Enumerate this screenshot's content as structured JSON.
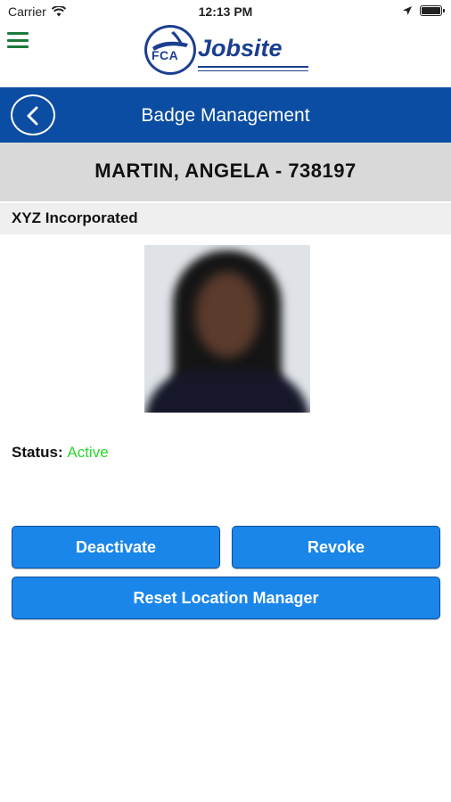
{
  "status_bar": {
    "carrier": "Carrier",
    "time": "12:13 PM",
    "battery_level": 1.0
  },
  "header": {
    "menu_icon": "hamburger-menu-icon",
    "logo_badge": "FCA",
    "logo_word": "Jobsite",
    "accent_color": "#1b3f8f",
    "menu_color": "#1d7a3a"
  },
  "titlebar": {
    "back_icon": "chevron-left-icon",
    "title": "Badge Management",
    "background_color": "#0b4da2"
  },
  "badge": {
    "name": "MARTIN, ANGELA - 738197",
    "company": "XYZ Incorporated",
    "status_label": "Status:",
    "status_value": "Active",
    "status_color": "#2ad62a"
  },
  "actions": {
    "deactivate_label": "Deactivate",
    "revoke_label": "Revoke",
    "reset_label": "Reset Location Manager",
    "button_color": "#1a86ea"
  }
}
